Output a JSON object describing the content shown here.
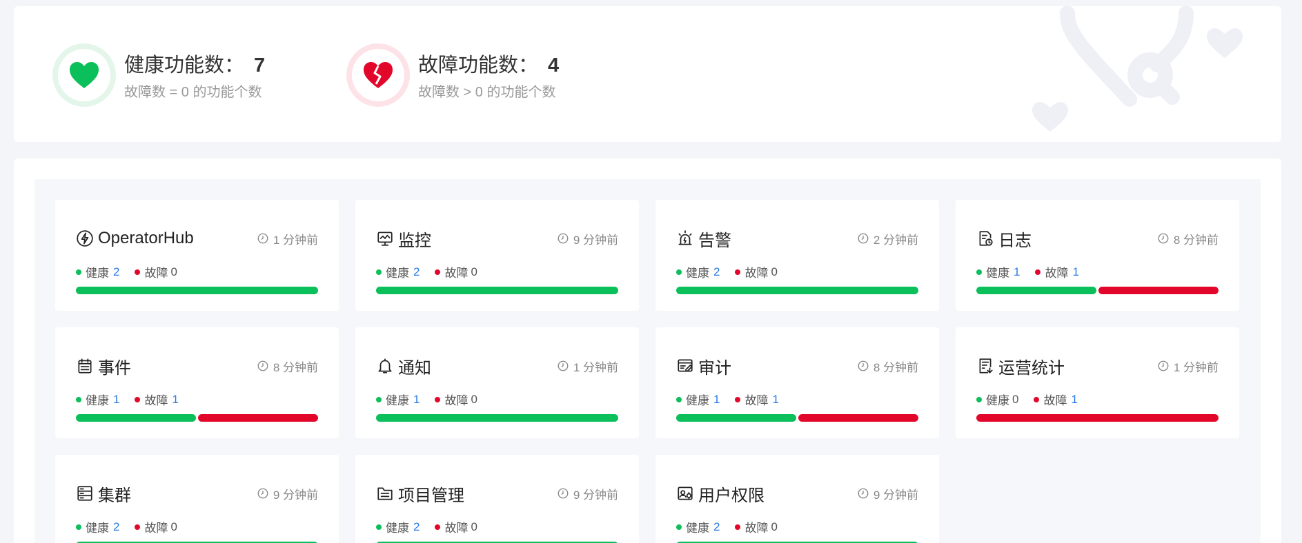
{
  "summary": {
    "healthy": {
      "title": "健康功能数：",
      "count": "7",
      "sub": "故障数 = 0 的功能个数"
    },
    "faulty": {
      "title": "故障功能数：",
      "count": "4",
      "sub": "故障数 > 0 的功能个数"
    }
  },
  "colors": {
    "healthy": "#0bbf5a",
    "faulty": "#e2072a",
    "link": "#2a7be4"
  },
  "cards": [
    {
      "title": "OperatorHub",
      "icon": "lightning-icon",
      "time": "1 分钟前",
      "healthy_label": "健康",
      "healthy": 2,
      "fault_label": "故障",
      "fault": 0
    },
    {
      "title": "监控",
      "icon": "monitor-icon",
      "time": "9 分钟前",
      "healthy_label": "健康",
      "healthy": 2,
      "fault_label": "故障",
      "fault": 0
    },
    {
      "title": "告警",
      "icon": "alarm-icon",
      "time": "2 分钟前",
      "healthy_label": "健康",
      "healthy": 2,
      "fault_label": "故障",
      "fault": 0
    },
    {
      "title": "日志",
      "icon": "log-icon",
      "time": "8 分钟前",
      "healthy_label": "健康",
      "healthy": 1,
      "fault_label": "故障",
      "fault": 1
    },
    {
      "title": "事件",
      "icon": "calendar-icon",
      "time": "8 分钟前",
      "healthy_label": "健康",
      "healthy": 1,
      "fault_label": "故障",
      "fault": 1
    },
    {
      "title": "通知",
      "icon": "bell-icon",
      "time": "1 分钟前",
      "healthy_label": "健康",
      "healthy": 1,
      "fault_label": "故障",
      "fault": 0
    },
    {
      "title": "审计",
      "icon": "audit-icon",
      "time": "8 分钟前",
      "healthy_label": "健康",
      "healthy": 1,
      "fault_label": "故障",
      "fault": 1
    },
    {
      "title": "运营统计",
      "icon": "report-icon",
      "time": "1 分钟前",
      "healthy_label": "健康",
      "healthy": 0,
      "fault_label": "故障",
      "fault": 1
    },
    {
      "title": "集群",
      "icon": "cluster-icon",
      "time": "9 分钟前",
      "healthy_label": "健康",
      "healthy": 2,
      "fault_label": "故障",
      "fault": 0
    },
    {
      "title": "项目管理",
      "icon": "folder-icon",
      "time": "9 分钟前",
      "healthy_label": "健康",
      "healthy": 2,
      "fault_label": "故障",
      "fault": 0
    },
    {
      "title": "用户权限",
      "icon": "user-permission-icon",
      "time": "9 分钟前",
      "healthy_label": "健康",
      "healthy": 2,
      "fault_label": "故障",
      "fault": 0
    }
  ]
}
